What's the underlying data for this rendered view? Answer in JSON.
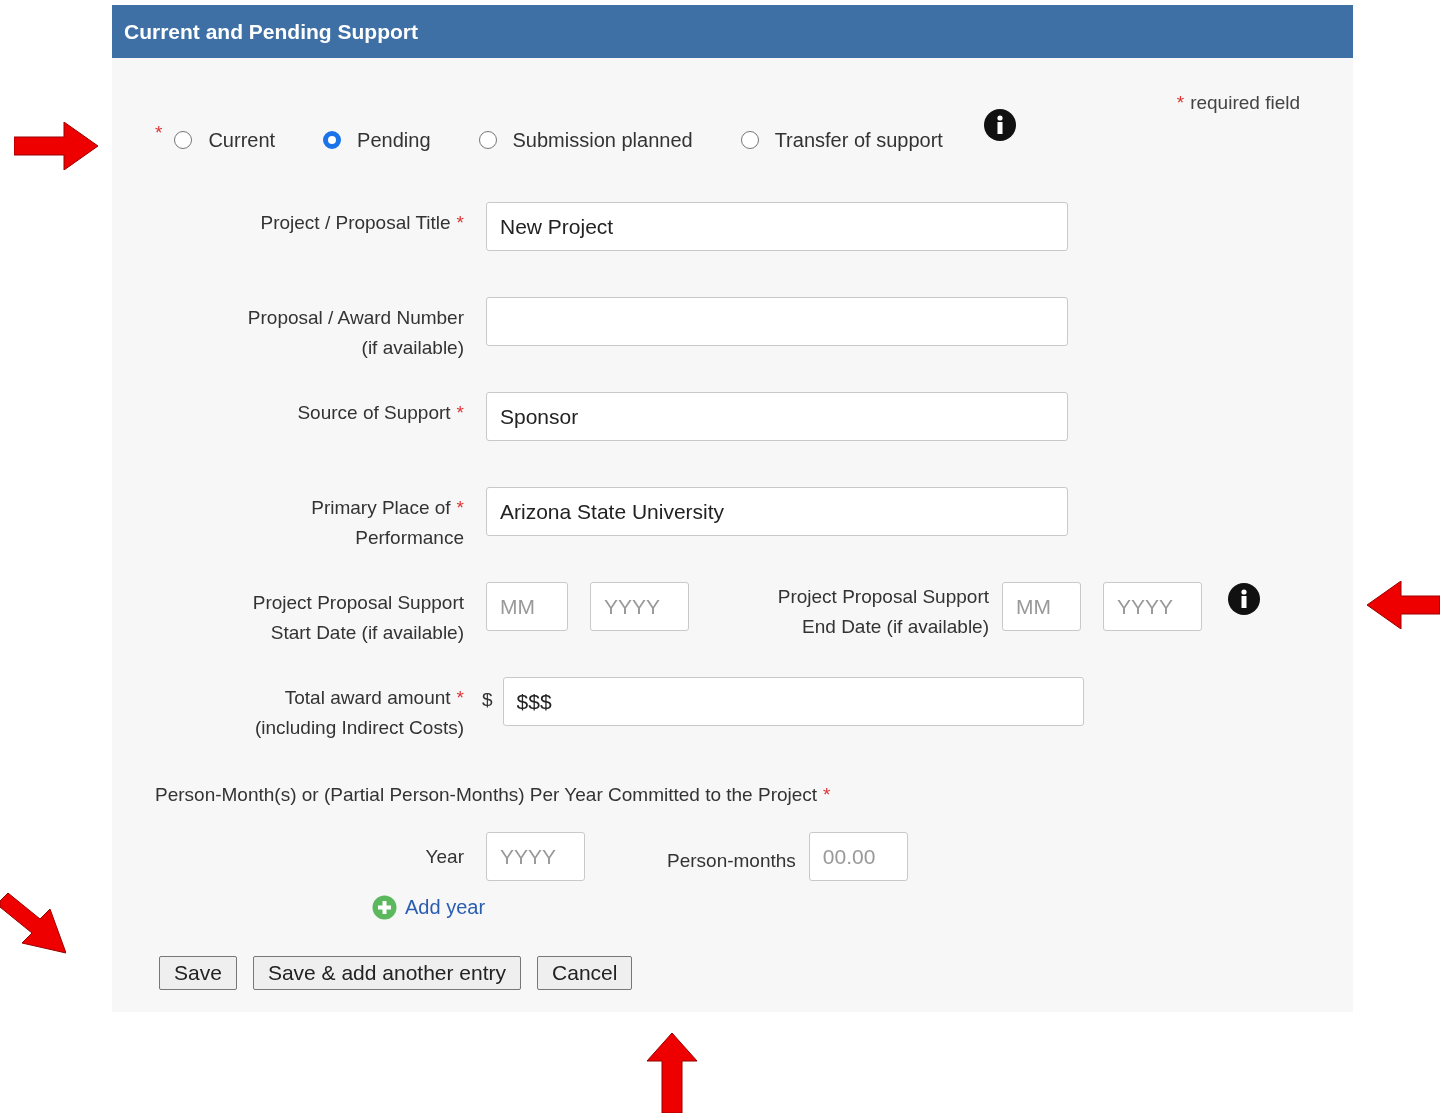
{
  "panel": {
    "title": "Current and Pending Support"
  },
  "required_note": {
    "marker": "*",
    "text": "required field"
  },
  "status": {
    "marker": "*",
    "options": [
      {
        "label": "Current",
        "selected": false
      },
      {
        "label": "Pending",
        "selected": true
      },
      {
        "label": "Submission planned",
        "selected": false
      },
      {
        "label": "Transfer of support",
        "selected": false
      }
    ]
  },
  "fields": [
    {
      "kind": "text",
      "label": [
        "Project / Proposal Title"
      ],
      "marker": "*",
      "value": "New Project"
    },
    {
      "kind": "text",
      "label": [
        "Proposal / Award Number",
        "(if available)"
      ]
    },
    {
      "kind": "text",
      "label": [
        "Source of Support"
      ],
      "marker": "*",
      "value": "Sponsor"
    },
    {
      "kind": "text",
      "label": [
        "Primary Place of",
        "Performance"
      ],
      "marker": "*",
      "value": "Arizona State University"
    },
    {
      "kind": "date_range",
      "label": [
        "Project Proposal Support",
        "Start Date (if available)"
      ],
      "start": [
        {
          "placeholder": "MM"
        },
        {
          "placeholder": "YYYY"
        }
      ],
      "end_label": [
        "Project Proposal Support",
        "End Date (if available)"
      ],
      "end": [
        {
          "placeholder": "MM"
        },
        {
          "placeholder": "YYYY"
        }
      ]
    },
    {
      "kind": "amount",
      "label": [
        "Total award amount",
        "(including Indirect Costs)"
      ],
      "marker": "*",
      "prefix": "$",
      "value": "$$$"
    }
  ],
  "person_months": {
    "heading": "Person-Month(s) or (Partial Person-Months) Per Year Committed to the Project",
    "marker": "*",
    "rows": [
      {
        "year_label": "Year",
        "year_placeholder": "YYYY",
        "months_label": "Person-months",
        "months_placeholder": "00.00"
      }
    ],
    "add_link": "Add year"
  },
  "buttons": [
    "Save",
    "Save & add another entry",
    "Cancel"
  ]
}
